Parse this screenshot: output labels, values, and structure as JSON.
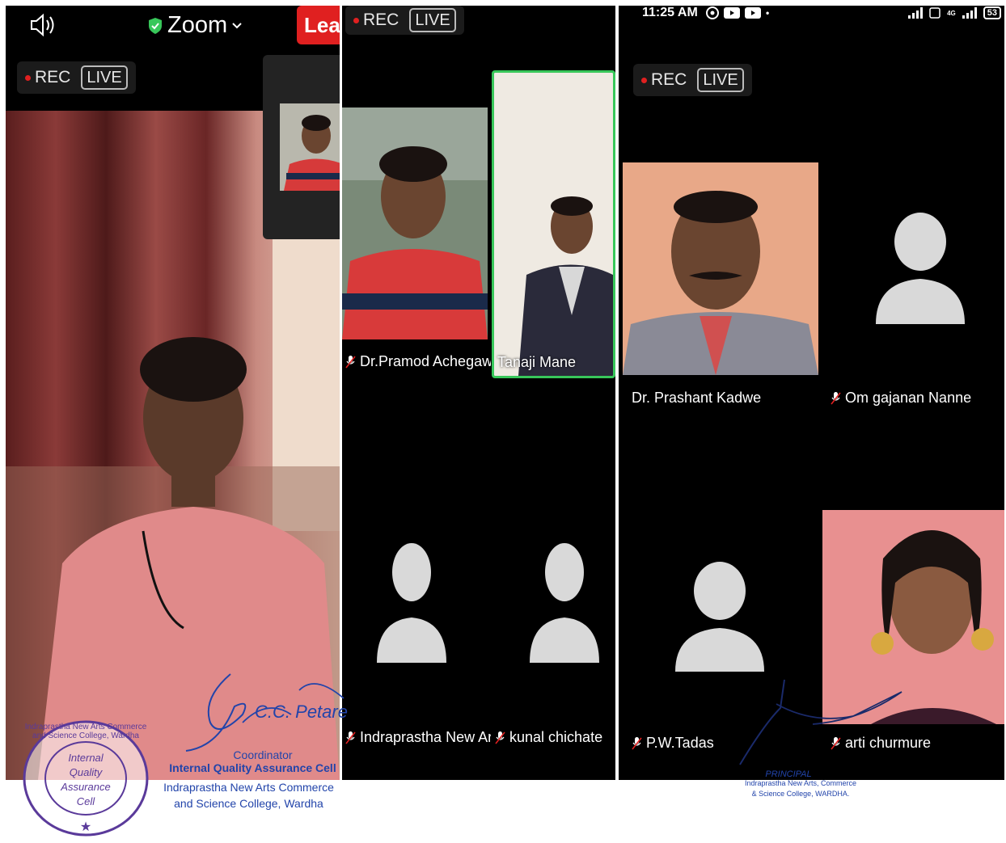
{
  "zoom_app": {
    "title": "Zoom",
    "leave_label": "Leave",
    "rec_label": "REC",
    "live_label": "LIVE"
  },
  "status_bar": {
    "time": "11:25 AM",
    "network": "4G",
    "battery": "53"
  },
  "participants": [
    {
      "name": "Dr.Pramod Achegawe",
      "muted": true
    },
    {
      "name": "Tanaji Mane",
      "muted": false,
      "active_speaker": true
    },
    {
      "name": "Indraprastha New Arts C...",
      "muted": true
    },
    {
      "name": "kunal chichate",
      "muted": true
    },
    {
      "name": "Dr. Prashant Kadwe",
      "muted": false
    },
    {
      "name": "Om gajanan Nanne",
      "muted": true
    },
    {
      "name": "P.W.Tadas",
      "muted": true
    },
    {
      "name": "arti churmure",
      "muted": true
    }
  ],
  "coordinator_signature": {
    "signed_name": "C.C. Petare",
    "title": "Coordinator",
    "cell": "Internal Quality Assurance Cell",
    "college_line1": "Indraprastha New Arts Commerce",
    "college_line2": "and Science College, Wardha"
  },
  "seal_stamp": {
    "ring_text": "Indraprastha New Arts Commerce and Science College, Wardha",
    "center_line1": "Internal",
    "center_line2": "Quality",
    "center_line3": "Assurance",
    "center_line4": "Cell"
  },
  "principal_signature": {
    "title": "PRINCIPAL",
    "college_line1": "Indraprastha New Arts, Commerce",
    "college_line2": "& Science College, WARDHA."
  },
  "colors": {
    "leave_red": "#e02020",
    "active_speaker_green": "#38c75a",
    "stamp_blue": "#2244aa",
    "avatar_grey": "#d9d9d9"
  }
}
